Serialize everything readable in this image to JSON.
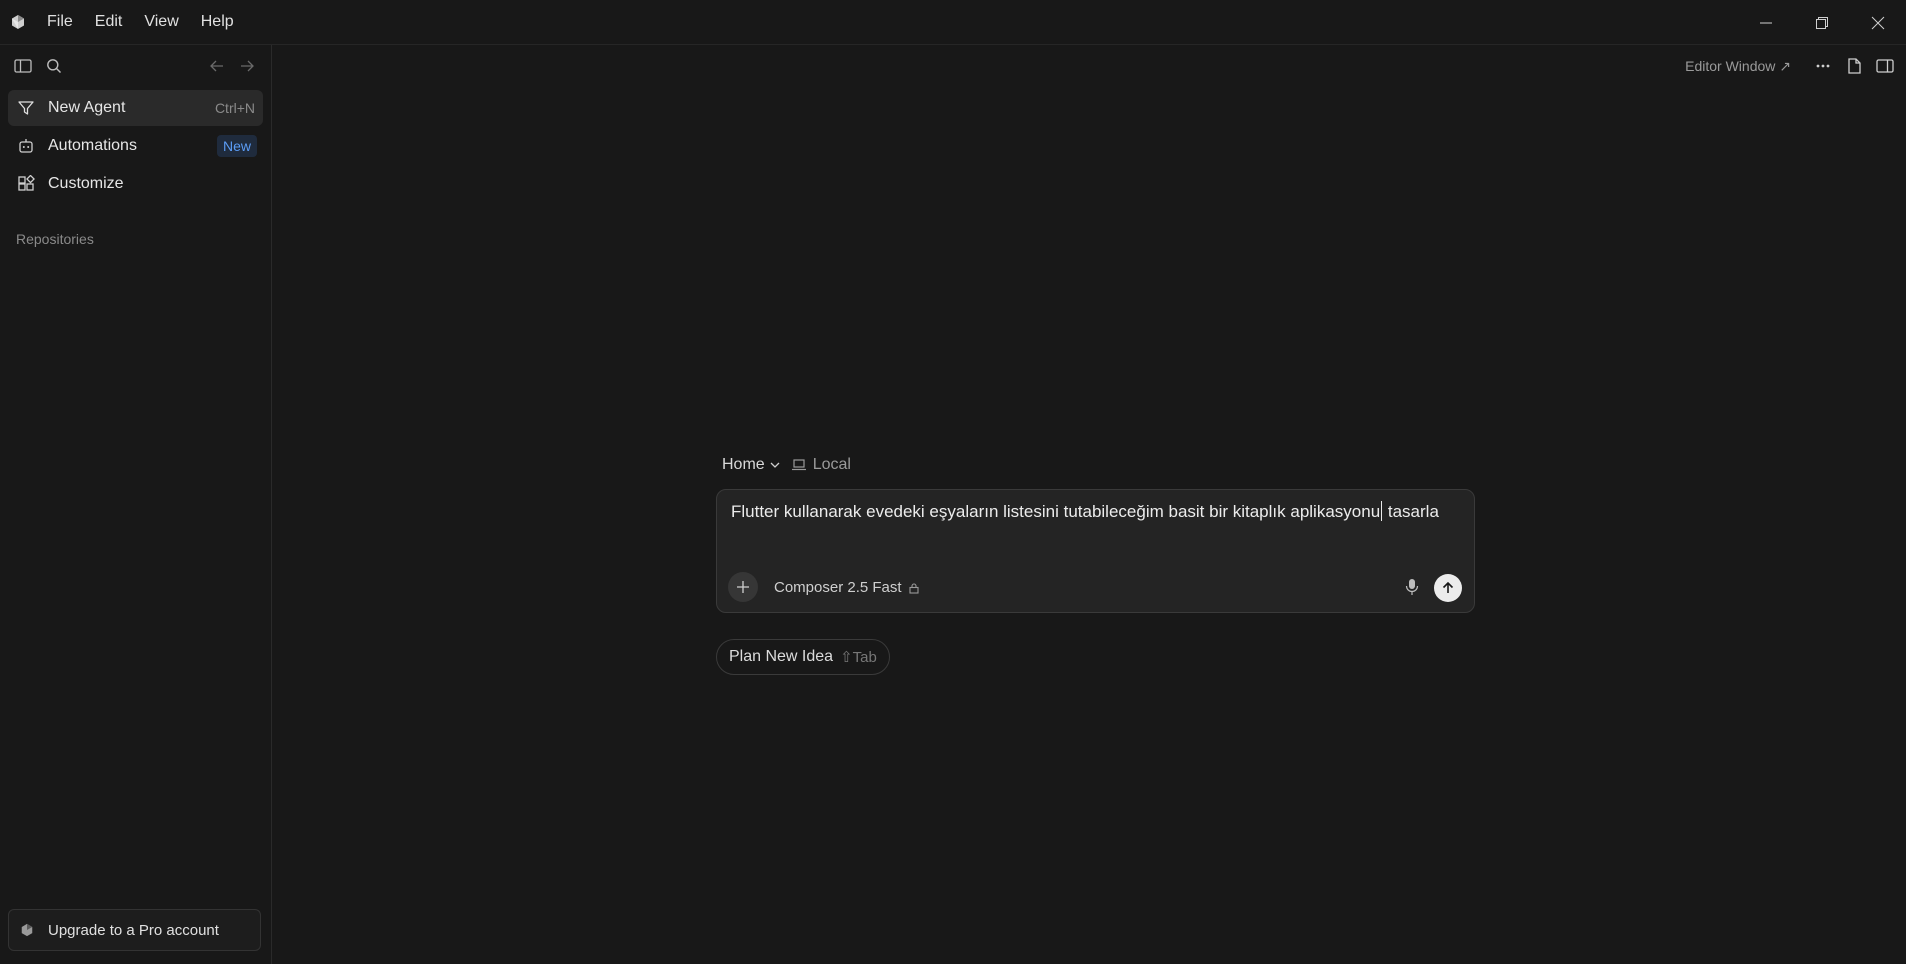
{
  "titlebar": {
    "logo_icon": "cursor-cube-icon",
    "menu": [
      {
        "label": "File"
      },
      {
        "label": "Edit"
      },
      {
        "label": "View"
      },
      {
        "label": "Help"
      }
    ]
  },
  "sidebar": {
    "nav": [
      {
        "label": "New Agent",
        "shortcut": "Ctrl+N",
        "icon": "agent-icon",
        "active": true
      },
      {
        "label": "Automations",
        "badge": "New",
        "icon": "robot-icon"
      },
      {
        "label": "Customize",
        "icon": "customize-icon"
      }
    ],
    "section_title": "Repositories",
    "upgrade_label": "Upgrade to a Pro account"
  },
  "main": {
    "editor_window_label": "Editor Window ↗",
    "context": {
      "home_label": "Home",
      "local_label": "Local"
    },
    "composer": {
      "prompt_before_caret": "Flutter kullanarak evedeki eşyaların listesini tutabileceğim basit bir kitaplık aplikasyonu",
      "prompt_after_caret": " tasarla",
      "model_label": "Composer 2.5 Fast"
    },
    "plan_chip": {
      "label": "Plan New Idea",
      "hint": "⇧Tab"
    }
  },
  "colors": {
    "background": "#181818",
    "sidebar_active": "#2a2a2a",
    "accent_badge": "#5b9cf5",
    "composer_bg": "#242424"
  }
}
